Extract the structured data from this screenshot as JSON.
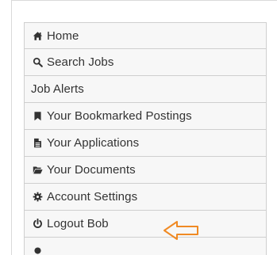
{
  "menu": {
    "items": [
      {
        "label": "Home",
        "icon": "home-icon"
      },
      {
        "label": "Search Jobs",
        "icon": "search-icon"
      },
      {
        "label": "Job Alerts",
        "icon": ""
      },
      {
        "label": "Your Bookmarked Postings",
        "icon": "bookmark-icon"
      },
      {
        "label": "Your Applications",
        "icon": "document-icon"
      },
      {
        "label": "Your Documents",
        "icon": "folder-open-icon"
      },
      {
        "label": "Account Settings",
        "icon": "gear-icon"
      },
      {
        "label": "Logout Bob",
        "icon": "power-icon"
      }
    ]
  },
  "colors": {
    "item_background": "#f7f7f7",
    "item_border": "#cfcfcf",
    "text": "#333333",
    "arrow_stroke": "#f08a24"
  },
  "annotation": {
    "icon": "left-arrow-icon"
  }
}
